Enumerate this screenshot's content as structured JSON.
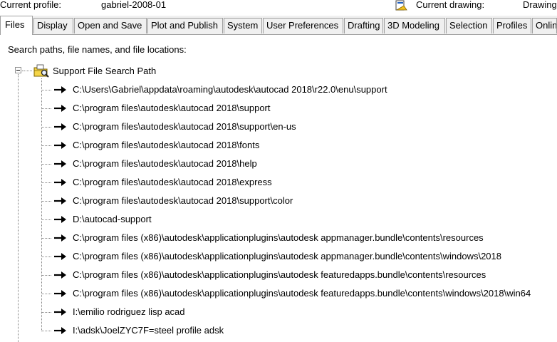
{
  "header": {
    "current_profile_label": "Current profile:",
    "current_profile_value": "gabriel-2008-01",
    "current_drawing_label": "Current drawing:",
    "current_drawing_value": "Drawing"
  },
  "tabs": [
    {
      "label": "Files"
    },
    {
      "label": "Display"
    },
    {
      "label": "Open and Save"
    },
    {
      "label": "Plot and Publish"
    },
    {
      "label": "System"
    },
    {
      "label": "User Preferences"
    },
    {
      "label": "Drafting"
    },
    {
      "label": "3D Modeling"
    },
    {
      "label": "Selection"
    },
    {
      "label": "Profiles"
    },
    {
      "label": "Onlin"
    }
  ],
  "active_tab": "Files",
  "section_label": "Search paths, file names, and file locations:",
  "tree": {
    "root_label": "Support File Search Path",
    "root_icon": "folder-search-icon",
    "item_icon": "arrow-right-icon",
    "items": [
      "C:\\Users\\Gabriel\\appdata\\roaming\\autodesk\\autocad 2018\\r22.0\\enu\\support",
      "C:\\program files\\autodesk\\autocad 2018\\support",
      "C:\\program files\\autodesk\\autocad 2018\\support\\en-us",
      "C:\\program files\\autodesk\\autocad 2018\\fonts",
      "C:\\program files\\autodesk\\autocad 2018\\help",
      "C:\\program files\\autodesk\\autocad 2018\\express",
      "C:\\program files\\autodesk\\autocad 2018\\support\\color",
      "D:\\autocad-support",
      "C:\\program files (x86)\\autodesk\\applicationplugins\\autodesk appmanager.bundle\\contents\\resources",
      "C:\\program files (x86)\\autodesk\\applicationplugins\\autodesk appmanager.bundle\\contents\\windows\\2018",
      "C:\\program files (x86)\\autodesk\\applicationplugins\\autodesk featuredapps.bundle\\contents\\resources",
      "C:\\program files (x86)\\autodesk\\applicationplugins\\autodesk featuredapps.bundle\\contents\\windows\\2018\\win64",
      "I:\\emilio rodriguez lisp acad",
      "I:\\adsk\\JoelZYC7F=steel profile adsk"
    ]
  }
}
